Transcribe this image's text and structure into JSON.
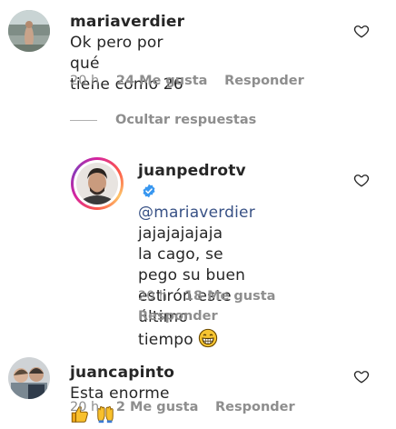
{
  "comments": [
    {
      "username": "mariaverdier",
      "text_line1": "Ok pero por qué",
      "text_line2": "tiene como 26",
      "time": "20 h",
      "likes": "24 Me gusta",
      "reply": "Responder"
    },
    {
      "username": "juanpedrotv",
      "mention": "@mariaverdier",
      "text_line1_rest": " jajajajajaja",
      "text_line2": "la cago, se pego su buen",
      "text_line3": "estirón este último",
      "text_line4": "tiempo",
      "time": "20 h",
      "likes": "18 Me gusta",
      "reply": "Responder",
      "verified": true,
      "emoji": "grinning-face"
    },
    {
      "username": "juancapinto",
      "text": "Esta enorme",
      "time": "20 h",
      "likes": "2 Me gusta",
      "reply": "Responder",
      "emojis": [
        "thumbs-up",
        "raising-hands"
      ]
    }
  ],
  "hide_replies": "Ocultar respuestas",
  "icons": {
    "like": "heart-icon",
    "verified": "verified-badge-icon"
  },
  "colors": {
    "text": "#262626",
    "muted": "#8e8e8e",
    "mention": "#385185",
    "verified": "#3897f0"
  }
}
